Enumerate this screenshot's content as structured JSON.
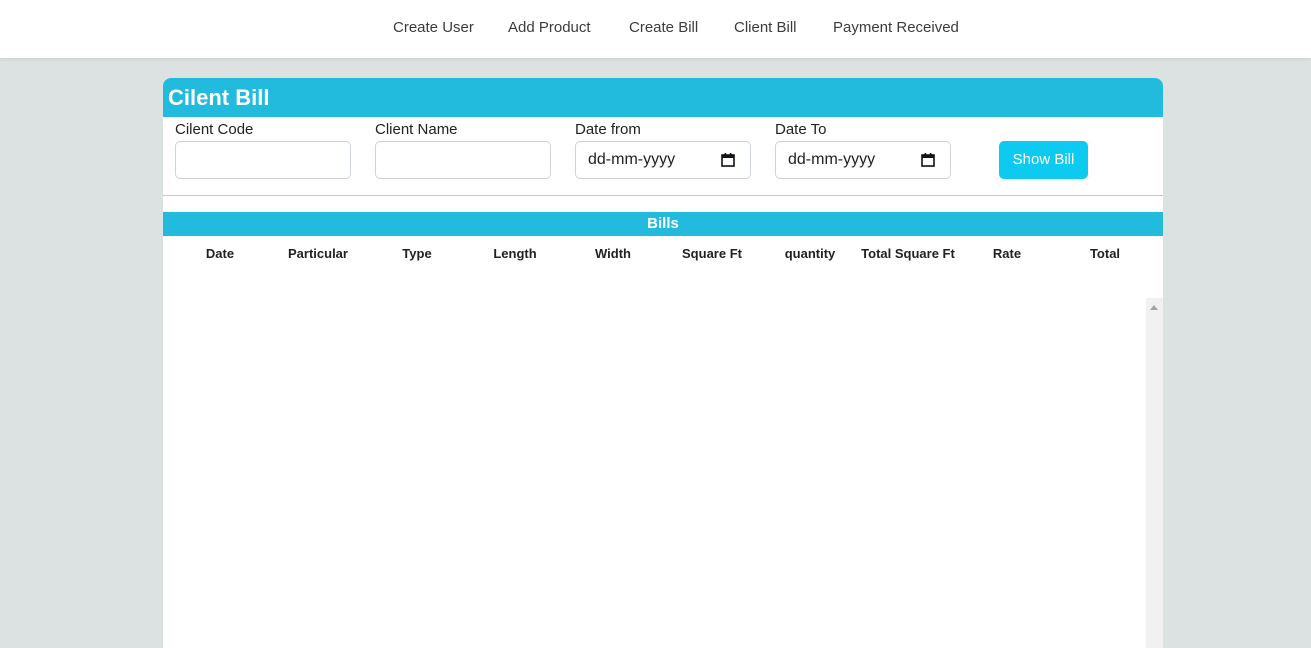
{
  "nav": {
    "items": [
      "Create User",
      "Add Product",
      "Create Bill",
      "Client Bill",
      "Payment Received"
    ]
  },
  "panel": {
    "title": "Cilent Bill"
  },
  "form": {
    "client_code_label": "Cilent Code",
    "client_code_value": "",
    "client_name_label": "Client Name",
    "client_name_value": "",
    "date_from_label": "Date from",
    "date_from_placeholder": "dd-mm-yyyy",
    "date_to_label": "Date To",
    "date_to_placeholder": "dd-mm-yyyy",
    "show_button_label": "Show Bill"
  },
  "bills": {
    "title": "Bills",
    "columns": [
      "Date",
      "Particular",
      "Type",
      "Length",
      "Width",
      "Square Ft",
      "quantity",
      "Total Square Ft",
      "Rate",
      "Total"
    ],
    "rows": []
  },
  "colors": {
    "accent": "#22bbdd",
    "button": "#0dcaf0",
    "background": "#dce1e1"
  },
  "icons": {
    "date_picker": "calendar-icon",
    "scroll": "scroll-up-arrow-icon"
  }
}
